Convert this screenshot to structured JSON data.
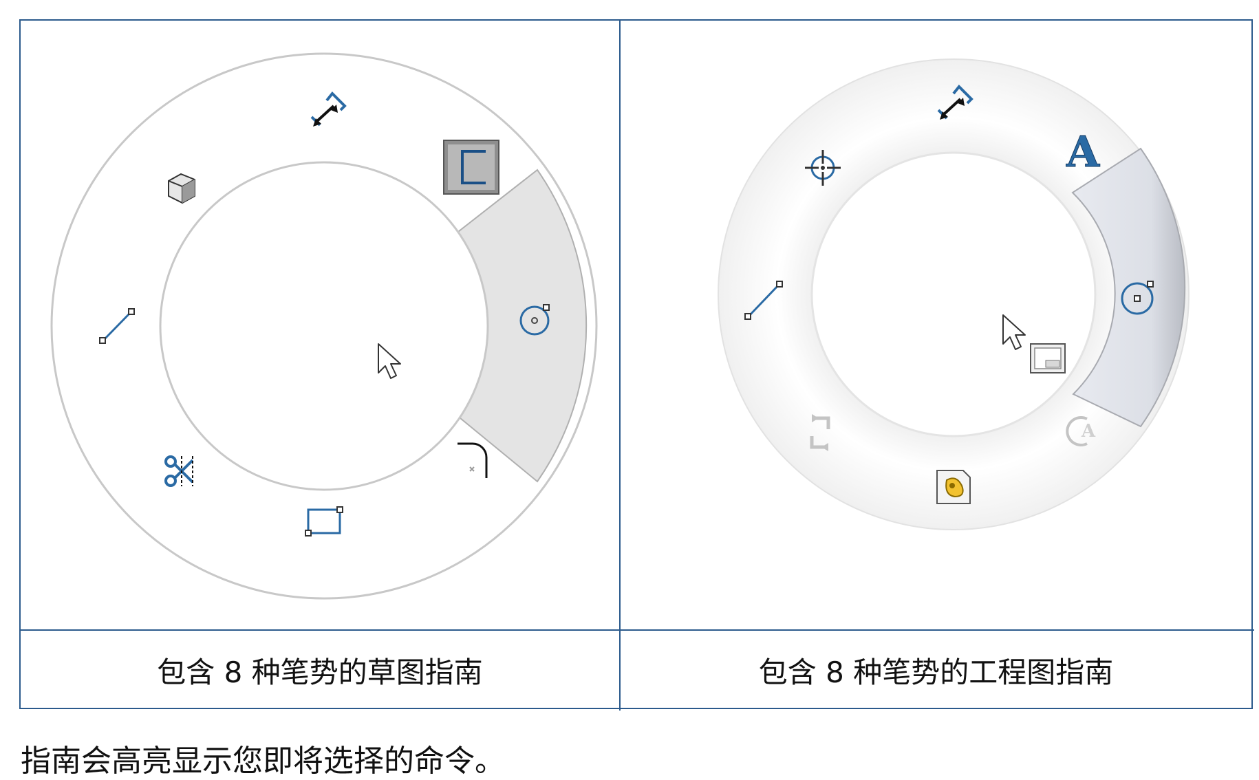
{
  "left_panel": {
    "caption": "包含 8 种笔势的草图指南",
    "gestures": [
      "smart-dimension-icon",
      "sketch-fillet-toolbar-icon",
      "circle-icon",
      "fillet-icon",
      "rectangle-icon",
      "trim-icon",
      "line-icon",
      "3d-view-icon"
    ],
    "highlighted": "circle-icon"
  },
  "right_panel": {
    "caption": "包含 8 种笔势的工程图指南",
    "gestures": [
      "smart-dimension-icon",
      "note-icon",
      "circle-icon",
      "centermark-a-icon",
      "model-items-icon",
      "rotate-view-icon",
      "line-icon",
      "center-mark-icon"
    ],
    "highlighted": "circle-icon"
  },
  "footer": {
    "text": "指南会高亮显示您即将选择的命令。"
  },
  "colors": {
    "border": "#2b5a8c",
    "icon_blue": "#2a6aa4",
    "highlight": "#e6e6e6"
  }
}
